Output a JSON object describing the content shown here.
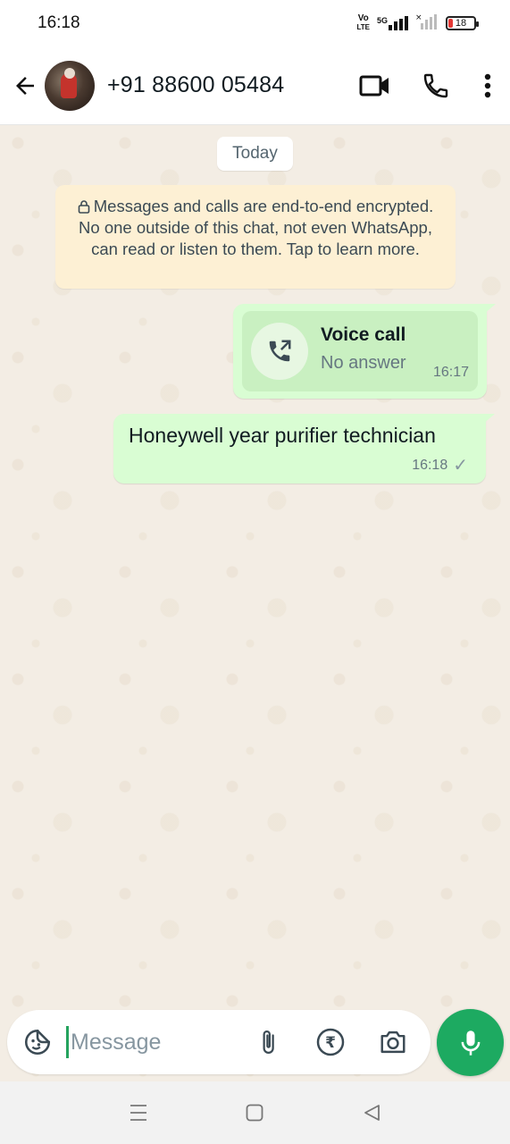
{
  "status_bar": {
    "time": "16:18",
    "volte_label_top": "Vo",
    "volte_label_bottom": "LTE",
    "network": "5G",
    "battery": "18",
    "battery_color": "#e53935"
  },
  "header": {
    "contact": "+91 88600 05484",
    "icons": [
      "back-arrow-icon",
      "video-call-icon",
      "phone-icon",
      "more-vert-icon"
    ]
  },
  "chat": {
    "date_chip": "Today",
    "encryption_notice": "Messages and calls are end-to-end encrypted. No one outside of this chat, not even WhatsApp, can read or listen to them. Tap to learn more.",
    "messages": [
      {
        "type": "call",
        "title": "Voice call",
        "status": "No answer",
        "time": "16:17"
      },
      {
        "type": "text",
        "text": "Honeywell year purifier technician",
        "time": "16:18",
        "tick": "✓"
      }
    ]
  },
  "composer": {
    "placeholder": "Message",
    "value": "",
    "accent": "#1daa61"
  },
  "colors": {
    "outgoing_bubble": "#d9fdd3",
    "notice_bg": "#fdf0d4",
    "chat_bg": "#f3ede4"
  }
}
